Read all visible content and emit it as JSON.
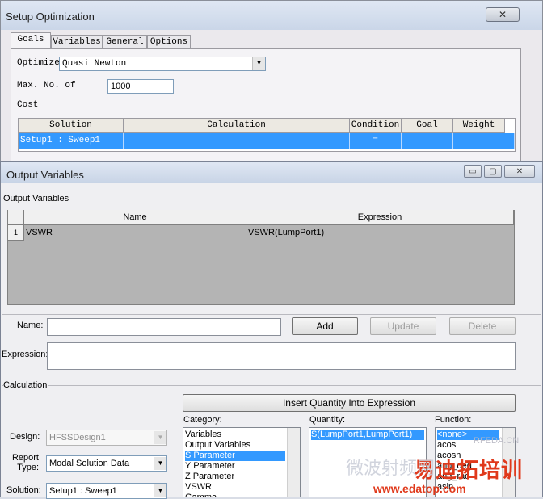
{
  "setup_window": {
    "title": "Setup Optimization",
    "close_glyph": "✕",
    "tabs": [
      {
        "label": "Goals"
      },
      {
        "label": "Variables"
      },
      {
        "label": "General"
      },
      {
        "label": "Options"
      }
    ],
    "optimizer_label": "Optimizer",
    "optimizer_value": "Quasi Newton",
    "max_label": "Max. No. of",
    "max_value": "1000",
    "cost_label": "Cost",
    "table_headers": [
      "Solution",
      "Calculation",
      "Condition",
      "Goal",
      "Weight"
    ],
    "row": {
      "solution": "Setup1 : Sweep1",
      "calculation": "",
      "condition": "=",
      "goal": "",
      "weight": ""
    }
  },
  "output_window": {
    "title": "Output Variables",
    "title_buttons": [
      "▭",
      "▢",
      "✕"
    ],
    "group_output_label": "Output Variables",
    "grid_headers": [
      "Name",
      "Expression"
    ],
    "rows": [
      {
        "index": "1",
        "name": "VSWR",
        "expression": "VSWR(LumpPort1)"
      }
    ],
    "name_label": "Name:",
    "name_value": "",
    "expression_label": "Expression:",
    "expression_value": "",
    "buttons": {
      "add": "Add",
      "update": "Update",
      "delete": "Delete"
    },
    "group_calc_label": "Calculation",
    "insert_button": "Insert Quantity Into Expression",
    "design_label": "Design:",
    "design_value": "HFSSDesign1",
    "report_type_label": "Report\nType:",
    "report_type_value": "Modal Solution Data",
    "solution_label": "Solution:",
    "solution_value": "Setup1 : Sweep1",
    "category_label": "Category:",
    "category_items": [
      "Variables",
      "Output Variables",
      "S Parameter",
      "Y Parameter",
      "Z Parameter",
      "VSWR",
      "Gamma"
    ],
    "category_selected": 2,
    "quantity_label": "Quantity:",
    "quantity_items": [
      "S(LumpPort1,LumpPort1)"
    ],
    "function_label": "Function:",
    "function_items": [
      "<none>",
      "acos",
      "acosh",
      "ang_deg",
      "ang_rad",
      "asin"
    ]
  },
  "watermark": {
    "brand_cn": "易迪拓培训",
    "sub_cn": "微波射频网",
    "url": "www.edatop.com",
    "corner": "RFEDA.CN"
  },
  "colors": {
    "selection": "#3399ff",
    "watermark_red": "#e0391b"
  }
}
